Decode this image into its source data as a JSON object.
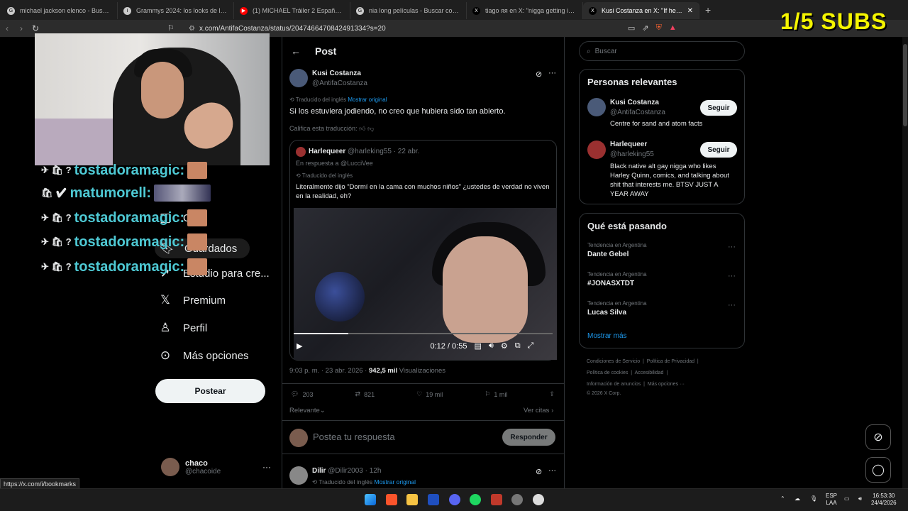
{
  "browser": {
    "tabs": [
      {
        "title": "michael jackson elenco - Buscar con",
        "favicon": "G"
      },
      {
        "title": "Grammys 2024: los looks de la alfom",
        "favicon": "i"
      },
      {
        "title": "(1) MICHAEL Tráiler 2 Español Latino",
        "favicon": "▶"
      },
      {
        "title": "nia long películas - Buscar con Goog",
        "favicon": "G"
      },
      {
        "title": "tiago ᴙᴙ en X: \"nigga getting intervie",
        "favicon": "X"
      },
      {
        "title": "Kusi Costanza en X: \"If he was fu",
        "favicon": "X",
        "active": true
      }
    ],
    "new_tab": "+",
    "url": "x.com/AntifaCostanza/status/2047466470842491334?s=20",
    "status_url": "https://x.com/i/bookmarks"
  },
  "overlay": {
    "subs": "1/5 SUBS",
    "chat": [
      {
        "name": "tostadoramagic:",
        "badges": "✈ 🛍 ?"
      },
      {
        "name": "matumorell:",
        "badges": "🛍 ✔"
      },
      {
        "name": "tostadoramagic:",
        "badges": "✈ 🛍 ?"
      },
      {
        "name": "tostadoramagic:",
        "badges": "✈ 🛍 ?"
      },
      {
        "name": "tostadoramagic:",
        "badges": "✈ 🛍 ?"
      }
    ]
  },
  "sidebar": {
    "items": [
      {
        "label": "Gr",
        "icon": "grok-icon"
      },
      {
        "label": "Guardados",
        "icon": "bookmark-icon"
      },
      {
        "label": "Estudio para cre...",
        "icon": "rocket-icon"
      },
      {
        "label": "Premium",
        "icon": "x-icon"
      },
      {
        "label": "Perfil",
        "icon": "person-icon"
      },
      {
        "label": "Más opciones",
        "icon": "more-circle-icon"
      }
    ],
    "post_button": "Postear",
    "account": {
      "name": "chaco",
      "handle": "@chacoide"
    }
  },
  "post": {
    "header": "Post",
    "author": {
      "name": "Kusi Costanza",
      "handle": "@AntifaCostanza"
    },
    "translated_note": "Traducido del inglés",
    "show_original": "Mostrar original",
    "text": "Si los estuviera jodiendo, no creo que hubiera sido tan abierto.",
    "rate_translation": "Califica esta traducción:",
    "quote": {
      "name": "Harlequeer",
      "handle": "@harleking55",
      "date": "· 22 abr.",
      "reply_to": "En respuesta a @LucciVee",
      "translated_note": "Traducido del inglés",
      "text": "Literalmente dijo “Dormí en la cama con muchos niños” ¿ustedes de verdad no viven en la realidad, eh?",
      "video_time": "0:12 / 0:55",
      "video_progress": 0.21
    },
    "meta_time": "9:03 p. m. · 23 abr. 2026 ·",
    "views_count": "942,5 mil",
    "views_label": "Visualizaciones",
    "stats": {
      "replies": "203",
      "reposts": "821",
      "likes": "19 mil",
      "bookmarks": "1 mil"
    },
    "sort_label": "Relevante",
    "quotes_link": "Ver citas",
    "reply_placeholder": "Postea tu respuesta",
    "reply_button": "Responder",
    "next_reply": {
      "name": "Dilir",
      "handle": "@Dilir2003 · 12h",
      "translated_note": "Traducido del inglés",
      "show_original": "Mostrar original"
    }
  },
  "right": {
    "search_placeholder": "Buscar",
    "relevant_title": "Personas relevantes",
    "people": [
      {
        "name": "Kusi Costanza",
        "handle": "@AntifaCostanza",
        "bio": "Centre for sand and atom facts",
        "button": "Seguir"
      },
      {
        "name": "Harlequeer",
        "handle": "@harleking55",
        "bio": "Black native alt gay nigga who likes Harley Quinn, comics, and talking about shit that interests me. BTSV JUST A YEAR AWAY",
        "button": "Seguir"
      }
    ],
    "trends_title": "Qué está pasando",
    "trends": [
      {
        "context": "Tendencia en Argentina",
        "name": "Dante Gebel"
      },
      {
        "context": "Tendencia en Argentina",
        "name": "#JONASXTDT"
      },
      {
        "context": "Tendencia en Argentina",
        "name": "Lucas Silva"
      }
    ],
    "show_more": "Mostrar más",
    "footer": [
      "Condiciones de Servicio",
      "Política de Privacidad",
      "Política de cookies",
      "Accesibilidad",
      "Información de anuncios",
      "Más opciones ···",
      "© 2026 X Corp."
    ]
  },
  "taskbar": {
    "lang": "ESP",
    "lang2": "LAA",
    "time": "16:53:30",
    "date": "24/4/2026"
  }
}
